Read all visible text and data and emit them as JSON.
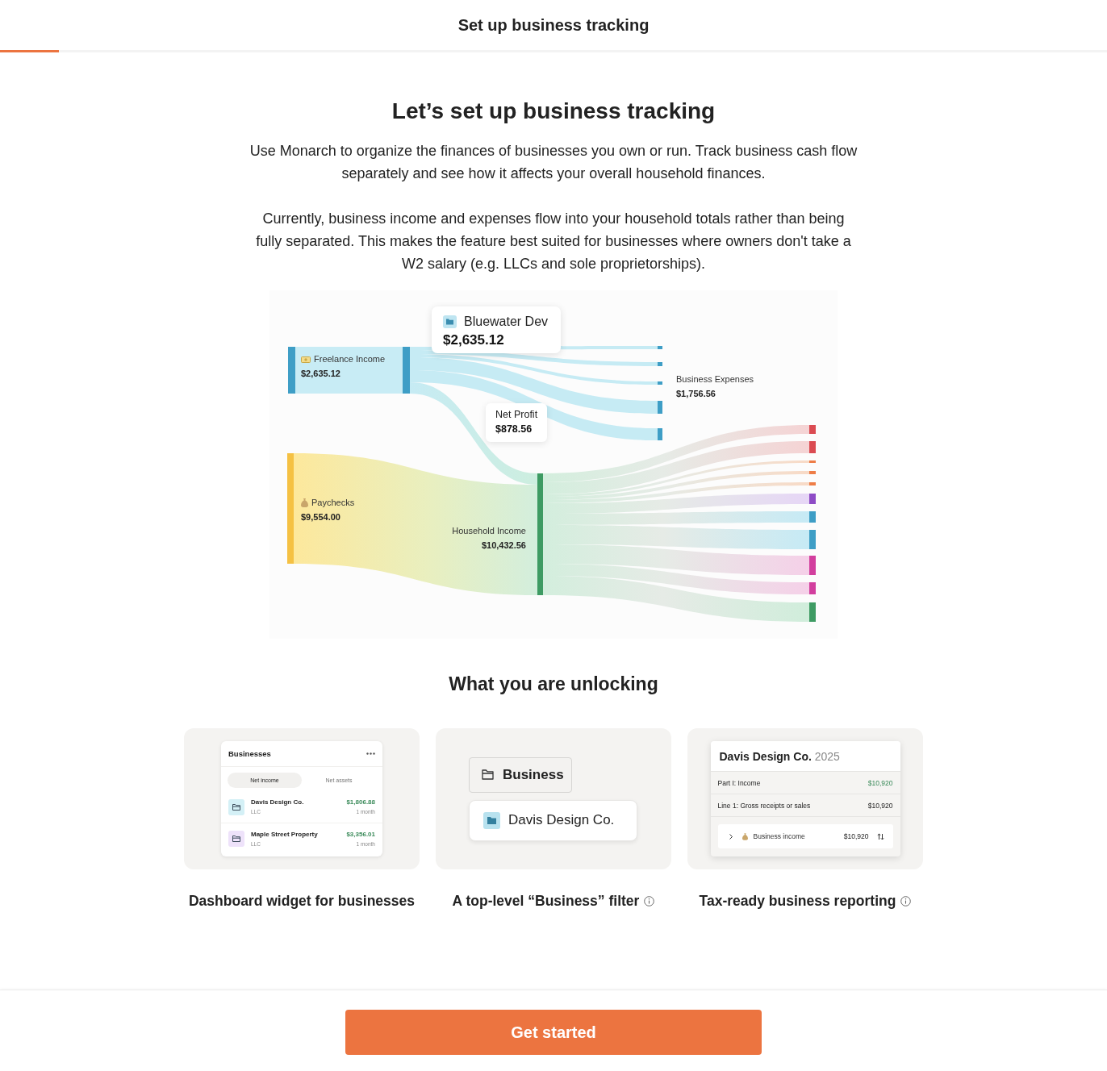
{
  "header": {
    "title": "Set up business tracking",
    "progress": {
      "level": 0.053
    }
  },
  "intro": {
    "heading": "Let’s set up business tracking",
    "paragraphs": [
      "Use Monarch to organize the finances of businesses you own or run. Track business cash flow separately and see how it affects your overall household finances.",
      "Currently, business income and expenses flow into your household totals rather than being fully separated. This makes the feature best suited for businesses where owners don't take a W2 salary (e.g. LLCs and sole proprietorships)."
    ]
  },
  "sankey": {
    "tooltip": {
      "title": "Bluewater Dev",
      "amount": "$2,635.12"
    },
    "freelance_income": {
      "label": "Freelance Income",
      "amount": "$2,635.12"
    },
    "net_profit": {
      "label": "Net Profit",
      "amount": "$878.56"
    },
    "business_expenses": {
      "label": "Business Expenses",
      "amount": "$1,756.56"
    },
    "paychecks": {
      "label": "Paychecks",
      "amount": "$9,554.00"
    },
    "household_income": {
      "label": "Household Income",
      "amount": "$10,432.56"
    }
  },
  "unlocking": {
    "heading": "What you are unlocking",
    "features": [
      {
        "kind": "widget",
        "caption": "Dashboard widget for businesses",
        "info": false,
        "widget": {
          "title": "Businesses",
          "tabs": [
            {
              "label": "Net income",
              "selected": true
            },
            {
              "label": "Net assets",
              "selected": false
            }
          ],
          "rows": [
            {
              "name": "Davis Design Co.",
              "type": "LLC",
              "amount": "$1,806.88",
              "period": "1 month",
              "color": "#d4f0f6"
            },
            {
              "name": "Maple Street Property",
              "type": "LLC",
              "amount": "$3,356.01",
              "period": "1 month",
              "color": "#eee2fa"
            }
          ]
        }
      },
      {
        "kind": "filter",
        "caption": "A top-level “Business” filter",
        "info": true,
        "filter": {
          "chip": "Business",
          "option": "Davis Design Co."
        }
      },
      {
        "kind": "report",
        "caption": "Tax-ready business reporting",
        "info": true,
        "report": {
          "title": "Davis Design Co.",
          "year": "2025",
          "rows": [
            {
              "kind": "section",
              "label": "Part I: Income",
              "amount": "$10,920"
            },
            {
              "kind": "line",
              "label": "Line 1: Gross receipts or sales",
              "amount": "$10,920"
            }
          ],
          "item": {
            "label": "Business income",
            "amount": "$10,920",
            "expanded": false
          }
        }
      }
    ]
  },
  "footer": {
    "button": "Get started"
  }
}
